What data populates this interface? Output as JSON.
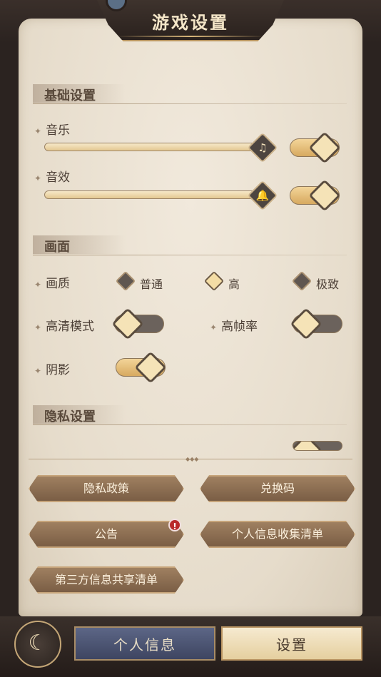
{
  "header": {
    "title": "游戏设置"
  },
  "sections": {
    "basic": {
      "title": "基础设置",
      "music": {
        "label": "音乐",
        "slider_level": 1.0,
        "enabled": true,
        "icon": "music-note-icon"
      },
      "sfx": {
        "label": "音效",
        "slider_level": 1.0,
        "enabled": true,
        "icon": "bell-icon"
      }
    },
    "display": {
      "title": "画面",
      "quality": {
        "label": "画质",
        "options": [
          "普通",
          "高",
          "极致"
        ],
        "selected": "高"
      },
      "hd_mode": {
        "label": "高清模式",
        "enabled": false
      },
      "high_fps": {
        "label": "高帧率",
        "enabled": false
      },
      "shadow": {
        "label": "阴影",
        "enabled": true
      }
    },
    "privacy": {
      "title": "隐私设置",
      "partial_item": {
        "enabled": false
      }
    }
  },
  "buttons": {
    "privacy_policy": "隐私政策",
    "redeem_code": "兑换码",
    "announcement": "公告",
    "announcement_badge": "!",
    "personal_info_list": "个人信息收集清单",
    "third_party_list": "第三方信息共享清单"
  },
  "tabs": {
    "personal_info": "个人信息",
    "settings": "设置",
    "active": "设置"
  },
  "colors": {
    "accent_gold": "#e1b66c",
    "badge_red": "#b92a2a",
    "inactive_tab": "#4f587a"
  }
}
